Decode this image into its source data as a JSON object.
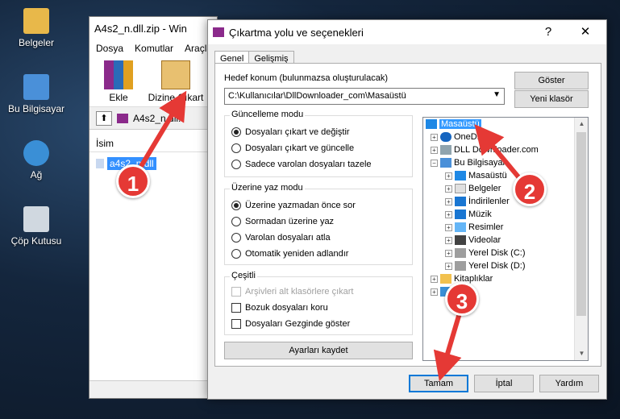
{
  "desktop": [
    {
      "label": "Belgeler",
      "icon": "folder-user-icon",
      "color": "#e8b84a"
    },
    {
      "label": "Bu Bilgisayar",
      "icon": "computer-icon",
      "color": "#4a90d9"
    },
    {
      "label": "Ağ",
      "icon": "network-icon",
      "color": "#3a8fd6"
    },
    {
      "label": "Çöp Kutusu",
      "icon": "recycle-bin-icon",
      "color": "#d0d8e0"
    }
  ],
  "winrar": {
    "title": "A4s2_n.dll.zip - Win",
    "menu": [
      "Dosya",
      "Komutlar",
      "Araçla"
    ],
    "toolbar": [
      "Ekle",
      "Dizine Çıkart"
    ],
    "path": "A4s2_n.dll.",
    "column": "İsim",
    "file": "a4s2_n.dll"
  },
  "dialog": {
    "title": "Çıkartma yolu ve seçenekleri",
    "help": "?",
    "close": "✕",
    "tabs": [
      "Genel",
      "Gelişmiş"
    ],
    "dest_label": "Hedef konum (bulunmazsa oluşturulacak)",
    "dest_value": "C:\\Kullanıcılar\\DllDownloader_com\\Masaüstü",
    "show_btn": "Göster",
    "newfolder_btn": "Yeni klasör",
    "update": {
      "title": "Güncelleme modu",
      "options": [
        "Dosyaları çıkart ve değiştir",
        "Dosyaları çıkart ve güncelle",
        "Sadece varolan dosyaları tazele"
      ],
      "selected": 0
    },
    "overwrite": {
      "title": "Üzerine yaz modu",
      "options": [
        "Üzerine yazmadan önce sor",
        "Sormadan üzerine yaz",
        "Varolan dosyaları atla",
        "Otomatik yeniden adlandır"
      ],
      "selected": 0
    },
    "misc": {
      "title": "Çeşitli",
      "options": [
        "Arşivleri alt klasörlere çıkart",
        "Bozuk dosyaları koru",
        "Dosyaları Gezginde göster"
      ]
    },
    "save_btn": "Ayarları kaydet",
    "tree": [
      "Masaüstü",
      "OneDrive",
      "DLL Downloader.com",
      "Bu Bilgisayar",
      "Masaüstü",
      "Belgeler",
      "İndirilenler",
      "Müzik",
      "Resimler",
      "Videolar",
      "Yerel Disk (C:)",
      "Yerel Disk (D:)",
      "Kitaplıklar",
      ""
    ],
    "ok": "Tamam",
    "cancel": "İptal",
    "help_btn": "Yardım"
  },
  "annotations": {
    "step1": "1",
    "step2": "2",
    "step3": "3",
    "color": "#e53935"
  }
}
